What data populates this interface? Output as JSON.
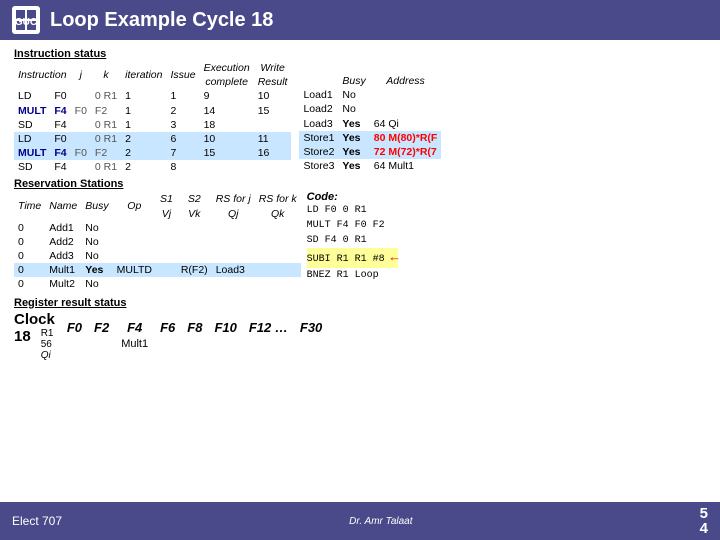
{
  "header": {
    "title": "Loop Example Cycle 18",
    "logo": "GUC"
  },
  "instruction_status": {
    "label": "Instruction status",
    "columns": [
      "Instruction",
      "j",
      "k",
      "iteration",
      "Issue",
      "Execution complete",
      "Write Result",
      "Busy",
      "Address"
    ],
    "rows": [
      {
        "instr": "LD",
        "reg": "F0",
        "j": "",
        "k": "0 R1",
        "iter": "1",
        "issue": "1",
        "exec": "9",
        "write": "10",
        "status": "Load1",
        "busy": "No",
        "addr": ""
      },
      {
        "instr": "MULT",
        "reg": "F4",
        "j": "F0",
        "k": "F2",
        "iter": "1",
        "issue": "2",
        "exec": "14",
        "write": "15",
        "status": "Load2",
        "busy": "No",
        "addr": ""
      },
      {
        "instr": "SD",
        "reg": "F4",
        "j": "",
        "k": "0 R1",
        "iter": "1",
        "issue": "3",
        "exec": "18",
        "write": "",
        "status": "Load3",
        "busy": "Yes",
        "addr": "64 Qi"
      },
      {
        "instr": "LD",
        "reg": "F0",
        "j": "",
        "k": "0 R1",
        "iter": "2",
        "issue": "6",
        "exec": "10",
        "write": "11",
        "status": "Store1",
        "busy": "Yes",
        "addr": "80 M(80)*R(F",
        "highlight": true
      },
      {
        "instr": "MULT",
        "reg": "F4",
        "j": "F0",
        "k": "F2",
        "iter": "2",
        "issue": "7",
        "exec": "15",
        "write": "16",
        "status": "Store2",
        "busy": "Yes",
        "addr": "72 M(72)*R(7",
        "highlight": true
      },
      {
        "instr": "SD",
        "reg": "F4",
        "j": "",
        "k": "0 R1",
        "iter": "2",
        "issue": "8",
        "exec": "",
        "write": "",
        "status": "Store3",
        "busy": "Yes",
        "addr": "64 Mult1"
      }
    ]
  },
  "reservation_stations": {
    "label": "Reservation Stations",
    "columns": [
      "Time",
      "Name",
      "Busy",
      "Op",
      "S1 Vj",
      "S2 Vk",
      "RS for j Qj",
      "RS for k Qk"
    ],
    "rows": [
      {
        "time": "0",
        "name": "Add1",
        "busy": "No",
        "op": "",
        "vj": "",
        "vk": "",
        "qj": "",
        "qk": ""
      },
      {
        "time": "0",
        "name": "Add2",
        "busy": "No",
        "op": "",
        "vj": "",
        "vk": "",
        "qj": "",
        "qk": ""
      },
      {
        "time": "0",
        "name": "Add3",
        "busy": "No",
        "op": "",
        "vj": "",
        "vk": "",
        "qj": "",
        "qk": ""
      },
      {
        "time": "0",
        "name": "Mult1",
        "busy": "Yes",
        "op": "MULTD",
        "vj": "",
        "vk": "R(F2)",
        "qj": "Load3",
        "qk": "",
        "highlight": true
      },
      {
        "time": "0",
        "name": "Mult2",
        "busy": "No",
        "op": "",
        "vj": "",
        "vk": "",
        "qj": "",
        "qk": ""
      }
    ]
  },
  "code": {
    "label": "Code:",
    "lines": [
      {
        "text": "LD   F0   0 R1",
        "highlight": false
      },
      {
        "text": "MULT F4   F0 F2",
        "highlight": false
      },
      {
        "text": "SD   F4   0 R1",
        "highlight": false
      },
      {
        "text": "SUBI R1   R1 #8",
        "highlight": true
      },
      {
        "text": "BNEZ R1   Loop",
        "highlight": false
      }
    ]
  },
  "register_result": {
    "label": "Register result status",
    "clock_label": "Clock",
    "clock_value": "18",
    "r1_label": "R1",
    "r1_value": "56",
    "qi_label": "Qi",
    "registers": [
      "F0",
      "F2",
      "F4",
      "F6",
      "F8",
      "F10",
      "F12 …",
      "F30"
    ],
    "values": [
      "",
      "",
      "Mult1",
      "",
      "",
      "",
      "",
      ""
    ]
  },
  "footer": {
    "course": "Elect 707",
    "instructor": "Dr. Amr Talaat",
    "page": "5\n4"
  },
  "colors": {
    "header_bg": "#4a4a8a",
    "highlight_blue": "#c8e6ff",
    "highlight_yellow": "#ffff99",
    "red": "#cc0000"
  }
}
